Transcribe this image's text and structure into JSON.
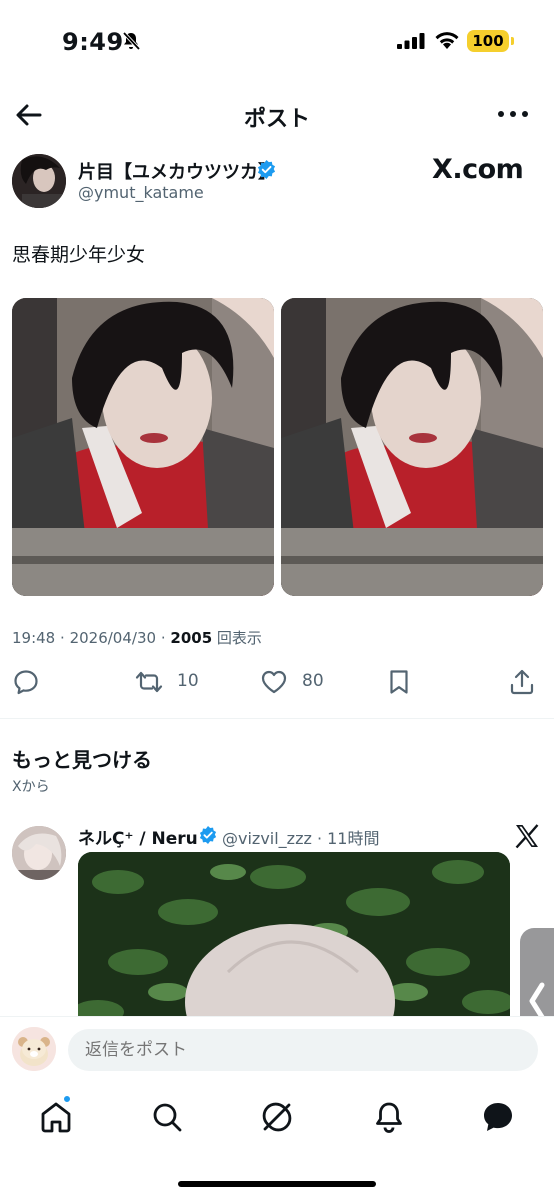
{
  "status_bar": {
    "time": "9:49",
    "battery": "100"
  },
  "nav": {
    "title": "ポスト"
  },
  "post": {
    "author_name": "片目【ユメカウツツカ】",
    "author_handle": "@ymut_katame",
    "brand": "X.com",
    "text": "思春期少年少女",
    "time": "19:48",
    "date": "2026/04/30",
    "separator": "·",
    "views_count": "2005",
    "views_label": "回表示",
    "reposts": "10",
    "likes": "80"
  },
  "discover": {
    "title": "もっと見つける",
    "subtitle": "Xから"
  },
  "suggested": {
    "name": "ネルÇ⁺ / Neru",
    "handle_time": "@vizvil_zzz · 11時間"
  },
  "reply": {
    "placeholder": "返信をポスト"
  },
  "colors": {
    "accent": "#1d9bf0",
    "battery": "#f5cf2d",
    "text_secondary": "#536471"
  }
}
